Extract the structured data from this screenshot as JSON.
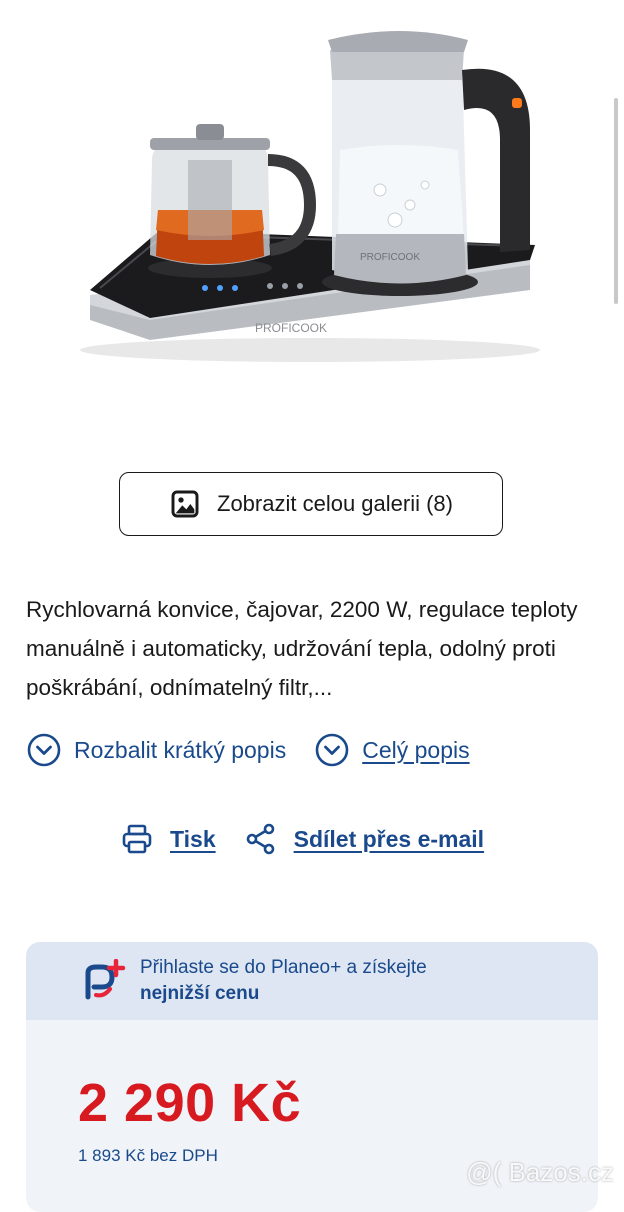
{
  "gallery": {
    "label": "Zobrazit celou galerii (8)"
  },
  "description": {
    "text": "Rychlovarná konvice, čajovar, 2200 W, regulace teploty manuálně i automaticky, udržování tepla, odolný proti poškrábání, odnímatelný filtr,..."
  },
  "links": {
    "expand_short": "Rozbalit krátký popis",
    "full_desc": "Celý popis"
  },
  "actions": {
    "print": "Tisk",
    "share_email": "Sdílet přes e-mail"
  },
  "planeo": {
    "line1": "Přihlaste se do Planeo+ a získejte",
    "line2": "nejnižší cenu"
  },
  "price": {
    "value": "2 290 Kč",
    "without_vat": "1 893 Kč bez DPH"
  },
  "watermark": {
    "text": "@( Bazos.cz"
  },
  "colors": {
    "link": "#1a4a8c",
    "price": "#d71920",
    "banner": "#dde6f2",
    "card": "#f0f3f8"
  },
  "icons": [
    "gallery-image-icon",
    "chevron-down-circle-icon",
    "printer-icon",
    "share-icon",
    "planeo-plus-logo"
  ]
}
